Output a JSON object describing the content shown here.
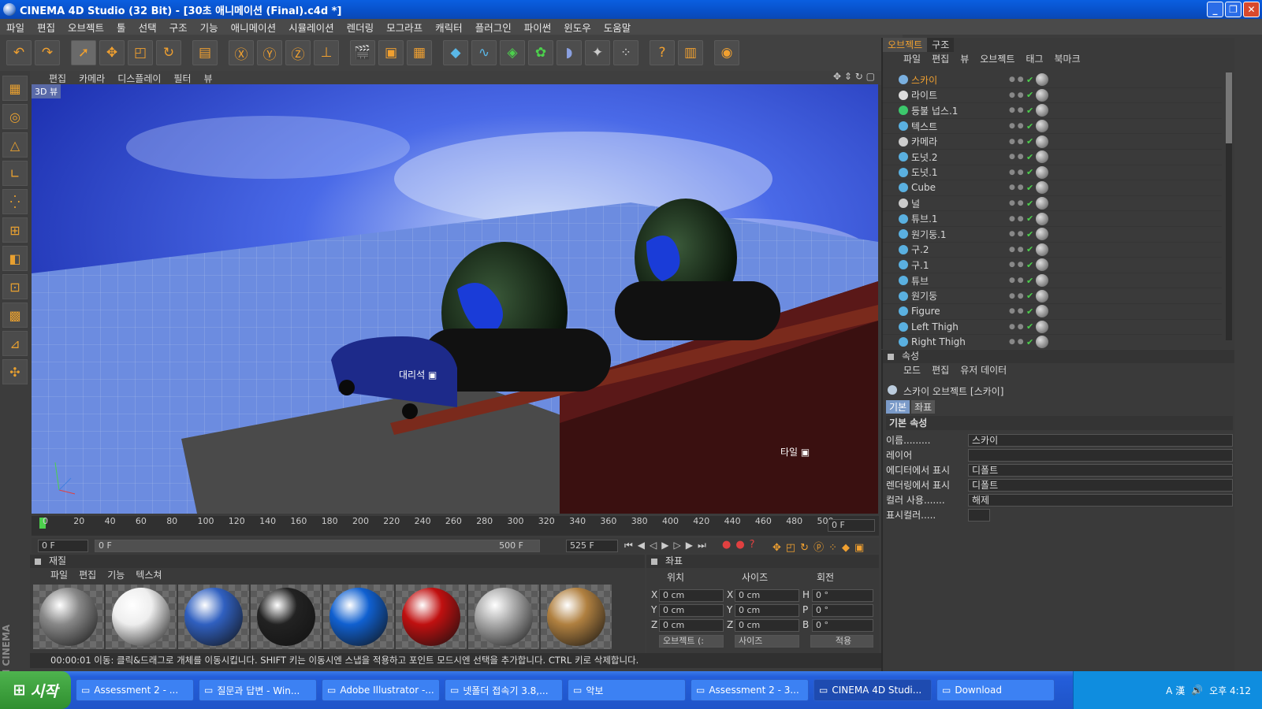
{
  "window": {
    "title": "CINEMA 4D Studio (32 Bit) - [30초 애니메이션 (Final).c4d *]"
  },
  "menu": [
    "파일",
    "편집",
    "오브젝트",
    "툴",
    "선택",
    "구조",
    "기능",
    "애니메이션",
    "시뮬레이션",
    "렌더링",
    "모그라프",
    "캐릭터",
    "플러그인",
    "파이썬",
    "윈도우",
    "도움말"
  ],
  "viewport": {
    "menu": [
      "편집",
      "카메라",
      "디스플레이",
      "필터",
      "뷰"
    ],
    "label": "3D 뷰",
    "labels": [
      "대리석",
      "타일"
    ]
  },
  "timeline": {
    "ticks": [
      "0",
      "20",
      "40",
      "60",
      "80",
      "100",
      "120",
      "140",
      "160",
      "180",
      "200",
      "220",
      "240",
      "260",
      "280",
      "300",
      "320",
      "340",
      "360",
      "380",
      "400",
      "420",
      "440",
      "460",
      "480",
      "500"
    ],
    "current": "0 F",
    "start": "0 F",
    "slider_start": "0 F",
    "slider_end": "500 F",
    "end": "525 F"
  },
  "materials": {
    "title": "재질",
    "menu": [
      "파일",
      "편집",
      "기능",
      "텍스쳐"
    ],
    "swatches": [
      {
        "color": "#888"
      },
      {
        "color": "#eee"
      },
      {
        "color": "#3060c0"
      },
      {
        "color": "#222"
      },
      {
        "color": "#1060d0"
      },
      {
        "color": "#c01010"
      },
      {
        "color": "#aaa"
      },
      {
        "color": "#b08040"
      }
    ]
  },
  "coords": {
    "title": "좌표",
    "headers": [
      "위치",
      "사이즈",
      "회전"
    ],
    "rows": [
      {
        "a": "X",
        "av": "0 cm",
        "b": "X",
        "bv": "0 cm",
        "c": "H",
        "cv": "0 °"
      },
      {
        "a": "Y",
        "av": "0 cm",
        "b": "Y",
        "bv": "0 cm",
        "c": "P",
        "cv": "0 °"
      },
      {
        "a": "Z",
        "av": "0 cm",
        "b": "Z",
        "bv": "0 cm",
        "c": "B",
        "cv": "0 °"
      }
    ],
    "mode": "오브젝트 (:",
    "size_mode": "사이즈",
    "apply": "적용"
  },
  "status": "00:00:01 이동: 클릭&드래그로 개체를 이동시킵니다. SHIFT 키는 이동시엔 스냅을 적용하고 포인트 모드시엔 선택을 추가합니다. CTRL 키로 삭제합니다.",
  "objects": {
    "tabs": [
      "오브젝트",
      "구조"
    ],
    "menu": [
      "파일",
      "편집",
      "뷰",
      "오브젝트",
      "태그",
      "북마크"
    ],
    "items": [
      {
        "name": "스카이",
        "sel": true,
        "color": "#7ab0e0"
      },
      {
        "name": "라이트",
        "color": "#ddd"
      },
      {
        "name": "등불 넙스.1",
        "color": "#3cc86c"
      },
      {
        "name": "텍스트",
        "color": "#5ab0e0"
      },
      {
        "name": "카메라",
        "color": "#ccc"
      },
      {
        "name": "도넛.2",
        "color": "#5ab0e0"
      },
      {
        "name": "도넛.1",
        "color": "#5ab0e0"
      },
      {
        "name": "Cube",
        "color": "#5ab0e0"
      },
      {
        "name": "널",
        "color": "#ccc"
      },
      {
        "name": "튜브.1",
        "color": "#5ab0e0"
      },
      {
        "name": "원기둥.1",
        "color": "#5ab0e0"
      },
      {
        "name": "구.2",
        "color": "#5ab0e0"
      },
      {
        "name": "구.1",
        "color": "#5ab0e0"
      },
      {
        "name": "튜브",
        "color": "#5ab0e0"
      },
      {
        "name": "원기둥",
        "color": "#5ab0e0"
      },
      {
        "name": "Figure",
        "color": "#5ab0e0"
      },
      {
        "name": "Left Thigh",
        "color": "#5ab0e0"
      },
      {
        "name": "Right Thigh",
        "color": "#5ab0e0"
      }
    ]
  },
  "attributes": {
    "title": "속성",
    "menu": [
      "모드",
      "편집",
      "유저 데이터"
    ],
    "object_title": "스카이 오브젝트 [스카이]",
    "tabs": [
      "기본",
      "좌표"
    ],
    "section": "기본 속성",
    "fields": [
      {
        "label": "이름.........",
        "value": "스카이"
      },
      {
        "label": "레이어",
        "value": ""
      },
      {
        "label": "에디터에서 표시",
        "value": "디폴트"
      },
      {
        "label": "렌더링에서 표시",
        "value": "디폴트"
      },
      {
        "label": "컬러 사용.......",
        "value": "해제"
      },
      {
        "label": "표시컬러.....",
        "value": ""
      }
    ]
  },
  "taskbar": {
    "start": "시작",
    "tasks": [
      "Assessment 2 - ...",
      "질문과 답변 - Win...",
      "Adobe Illustrator -...",
      "넷폴더 접속기 3.8,...",
      "악보",
      "Assessment 2 - 3...",
      "CINEMA 4D Studi...",
      "Download"
    ],
    "active": 6,
    "time": "오후 4:12"
  }
}
